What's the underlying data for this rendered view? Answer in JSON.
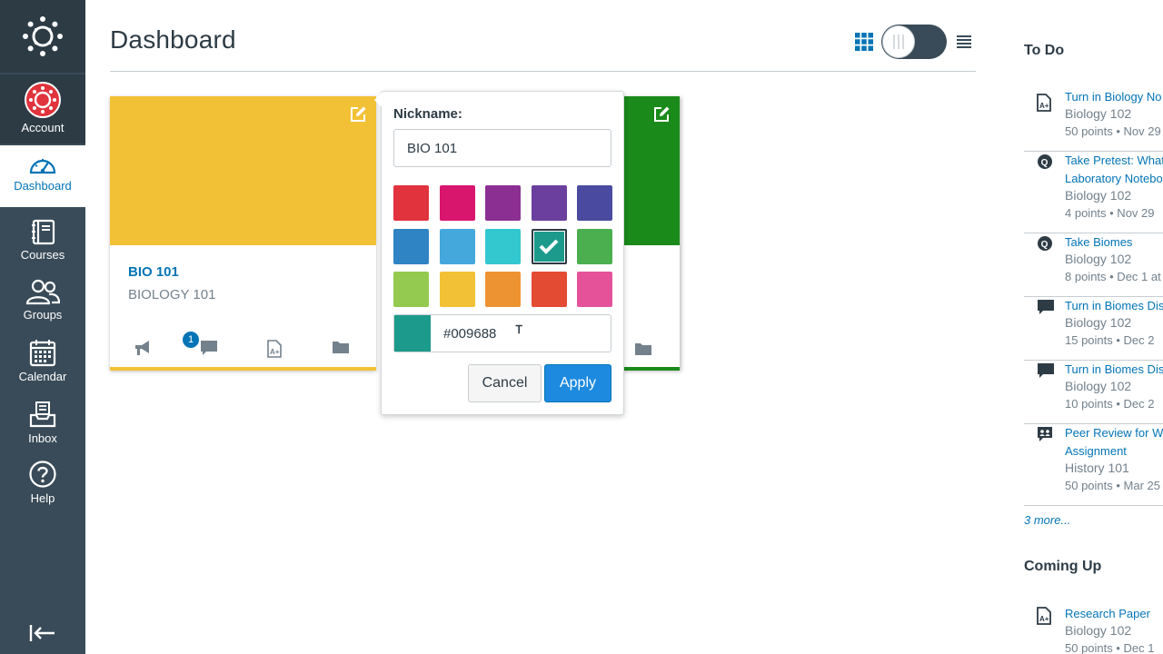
{
  "nav": {
    "account": "Account",
    "dashboard": "Dashboard",
    "courses": "Courses",
    "groups": "Groups",
    "calendar": "Calendar",
    "inbox": "Inbox",
    "help": "Help"
  },
  "header": {
    "title": "Dashboard"
  },
  "card1": {
    "title": "BIO 101",
    "subtitle": "BIOLOGY 101",
    "announcement_badge": "1",
    "color": "#f2c136"
  },
  "card2": {
    "color": "#1a8a1a"
  },
  "popover": {
    "nickname_label": "Nickname:",
    "nickname_value": "BIO 101",
    "swatches": [
      "#e0333d",
      "#d8166e",
      "#8b2f93",
      "#6a3f9d",
      "#4a4ba0",
      "#2f84c3",
      "#45a8dc",
      "#33c7cf",
      "#1c9a8b",
      "#4baf4f",
      "#94ca4f",
      "#f2c136",
      "#ee9332",
      "#e44b33",
      "#e5529a"
    ],
    "selected_index": 8,
    "hex_value": "#009688",
    "cancel_label": "Cancel",
    "apply_label": "Apply"
  },
  "todo": {
    "heading": "To Do",
    "items": [
      {
        "icon": "assignment-icon",
        "title": "Turn in Biology No",
        "title2": "",
        "course": "Biology 102",
        "meta": "50 points • Nov 29"
      },
      {
        "icon": "quiz-icon",
        "title": "Take Pretest: What",
        "title2": "Laboratory Notebo",
        "course": "Biology 102",
        "meta": "4 points • Nov 29"
      },
      {
        "icon": "quiz-icon",
        "title": "Take Biomes",
        "title2": "",
        "course": "Biology 102",
        "meta": "8 points • Dec 1 at"
      },
      {
        "icon": "discussion-icon",
        "title": "Turn in Biomes Dis",
        "title2": "",
        "course": "Biology 102",
        "meta": "15 points • Dec 2"
      },
      {
        "icon": "discussion-icon",
        "title": "Turn in Biomes Dis",
        "title2": "",
        "course": "Biology 102",
        "meta": "10 points • Dec 2"
      },
      {
        "icon": "peer-review-icon",
        "title": "Peer Review for W",
        "title2": "Assignment",
        "course": "History 101",
        "meta": "50 points • Mar 25"
      }
    ],
    "more": "3 more..."
  },
  "coming_up": {
    "heading": "Coming Up",
    "items": [
      {
        "icon": "assignment-icon",
        "title": "Research Paper",
        "course": "Biology 102",
        "meta": "50 points • Dec 1"
      }
    ]
  }
}
